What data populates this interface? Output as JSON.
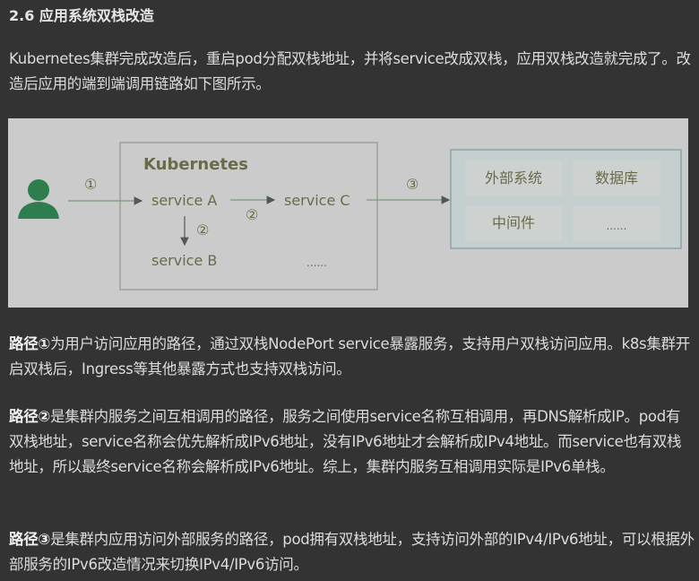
{
  "heading": "2.6 应用系统双栈改造",
  "intro": "Kubernetes集群完成改造后，重启pod分配双栈地址，并将service改成双栈，应用双栈改造就完成了。改造后应用的端到端调用链路如下图所示。",
  "diagram": {
    "cluster_title": "Kubernetes",
    "service_a": "service A",
    "service_b": "service B",
    "service_c": "service C",
    "cluster_more": "......",
    "path1": "①",
    "path2": "②",
    "path3": "③",
    "external": [
      "外部系统",
      "数据库",
      "中间件",
      "......"
    ],
    "user_color": "#2e7d4f"
  },
  "paragraphs": [
    {
      "label": "路径①",
      "text": "为用户访问应用的路径，通过双栈NodePort service暴露服务，支持用户双栈访问应用。k8s集群开启双栈后，Ingress等其他暴露方式也支持双栈访问。"
    },
    {
      "label": "路径②",
      "text": "是集群内服务之间互相调用的路径，服务之间使用service名称互相调用，再DNS解析成IP。pod有双栈地址，service名称会优先解析成IPv6地址，没有IPv6地址才会解析成IPv4地址。而service也有双栈地址，所以最终service名称会解析成IPv6地址。综上，集群内服务互相调用实际是IPv6单栈。"
    },
    {
      "label": "路径③",
      "text": "是集群内应用访问外部服务的路径，pod拥有双栈地址，支持访问外部的IPv4/IPv6地址，可以根据外部服务的IPv6改造情况来切换IPv4/IPv6访问。"
    }
  ]
}
